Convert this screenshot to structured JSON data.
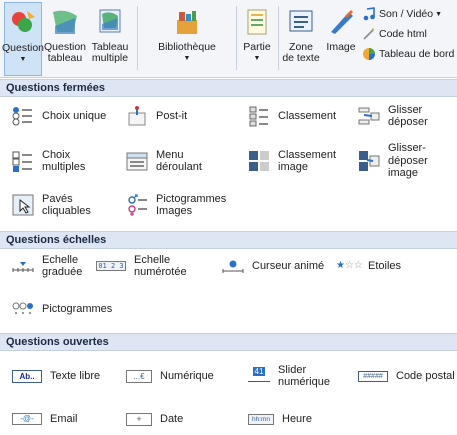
{
  "ribbon": {
    "question": "Question",
    "question_tableau": "Question\ntableau",
    "tableau_multiple": "Tableau\nmultiple",
    "bibliotheque": "Bibliothèque",
    "partie": "Partie",
    "zone_de_texte": "Zone\nde texte",
    "image": "Image",
    "son_video": "Son / Vidéo",
    "code_html": "Code html",
    "tableau_de_bord": "Tableau de bord"
  },
  "sections": {
    "fermees": "Questions fermées",
    "echelles": "Questions échelles",
    "ouvertes": "Questions ouvertes"
  },
  "fermees": {
    "choix_unique": "Choix unique",
    "post_it": "Post-it",
    "classement": "Classement",
    "glisser_deposer": "Glisser\ndéposer",
    "choix_multiples": "Choix\nmultiples",
    "menu_deroulant": "Menu\ndéroulant",
    "classement_image": "Classement\nimage",
    "glisser_deposer_image": "Glisser-\ndéposer image",
    "paves_cliquables": "Pavés\ncliquables",
    "pictogrammes_images": "Pictogrammes\nImages"
  },
  "echelles": {
    "echelle_graduee": "Echelle\ngraduée",
    "echelle_numerotee": "Echelle\nnumérotée",
    "curseur_anime": "Curseur animé",
    "etoiles": "Etoiles",
    "pictogrammes": "Pictogrammes"
  },
  "ouvertes": {
    "texte_libre": "Texte libre",
    "numerique": "Numérique",
    "slider_numerique": "Slider\nnumérique",
    "code_postal": "Code postal",
    "email": "Email",
    "date": "Date",
    "heure": "Heure"
  },
  "icon_text": {
    "texte_libre": "Ab..",
    "numerique": "...€",
    "slider_41": "41",
    "code_postal": "#####",
    "email": "-@-",
    "date": "+",
    "heure": "hh:mn",
    "echelle_numerotee": "01 2 3"
  }
}
